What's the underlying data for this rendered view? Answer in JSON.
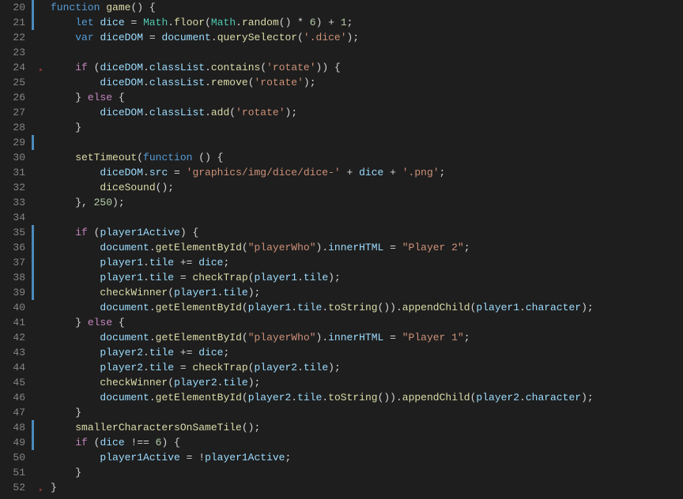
{
  "lineStart": 20,
  "lines": [
    [
      [
        "kw",
        "function"
      ],
      [
        "op",
        " "
      ],
      [
        "fn",
        "game"
      ],
      [
        "pn",
        "() {"
      ]
    ],
    [
      [
        "op",
        "    "
      ],
      [
        "kw",
        "let"
      ],
      [
        "op",
        " "
      ],
      [
        "var",
        "dice"
      ],
      [
        "op",
        " = "
      ],
      [
        "cls",
        "Math"
      ],
      [
        "pn",
        "."
      ],
      [
        "fn",
        "floor"
      ],
      [
        "pn",
        "("
      ],
      [
        "cls",
        "Math"
      ],
      [
        "pn",
        "."
      ],
      [
        "fn",
        "random"
      ],
      [
        "pn",
        "() * "
      ],
      [
        "num",
        "6"
      ],
      [
        "pn",
        ") + "
      ],
      [
        "num",
        "1"
      ],
      [
        "pn",
        ";"
      ]
    ],
    [
      [
        "op",
        "    "
      ],
      [
        "kw",
        "var"
      ],
      [
        "op",
        " "
      ],
      [
        "var",
        "diceDOM"
      ],
      [
        "op",
        " = "
      ],
      [
        "var",
        "document"
      ],
      [
        "pn",
        "."
      ],
      [
        "fn",
        "querySelector"
      ],
      [
        "pn",
        "("
      ],
      [
        "str",
        "'.dice'"
      ],
      [
        "pn",
        ");"
      ]
    ],
    [
      [
        "op",
        ""
      ]
    ],
    [
      [
        "op",
        "    "
      ],
      [
        "ctrl",
        "if"
      ],
      [
        "op",
        " ("
      ],
      [
        "var",
        "diceDOM"
      ],
      [
        "pn",
        "."
      ],
      [
        "prop",
        "classList"
      ],
      [
        "pn",
        "."
      ],
      [
        "fn",
        "contains"
      ],
      [
        "pn",
        "("
      ],
      [
        "str",
        "'rotate'"
      ],
      [
        "pn",
        ")) {"
      ]
    ],
    [
      [
        "op",
        "        "
      ],
      [
        "var",
        "diceDOM"
      ],
      [
        "pn",
        "."
      ],
      [
        "prop",
        "classList"
      ],
      [
        "pn",
        "."
      ],
      [
        "fn",
        "remove"
      ],
      [
        "pn",
        "("
      ],
      [
        "str",
        "'rotate'"
      ],
      [
        "pn",
        ");"
      ]
    ],
    [
      [
        "op",
        "    } "
      ],
      [
        "ctrl",
        "else"
      ],
      [
        "op",
        " {"
      ]
    ],
    [
      [
        "op",
        "        "
      ],
      [
        "var",
        "diceDOM"
      ],
      [
        "pn",
        "."
      ],
      [
        "prop",
        "classList"
      ],
      [
        "pn",
        "."
      ],
      [
        "fn",
        "add"
      ],
      [
        "pn",
        "("
      ],
      [
        "str",
        "'rotate'"
      ],
      [
        "pn",
        ");"
      ]
    ],
    [
      [
        "op",
        "    }"
      ]
    ],
    [
      [
        "op",
        ""
      ]
    ],
    [
      [
        "op",
        "    "
      ],
      [
        "fn",
        "setTimeout"
      ],
      [
        "pn",
        "("
      ],
      [
        "kw",
        "function"
      ],
      [
        "op",
        " () {"
      ]
    ],
    [
      [
        "op",
        "        "
      ],
      [
        "var",
        "diceDOM"
      ],
      [
        "pn",
        "."
      ],
      [
        "prop",
        "src"
      ],
      [
        "op",
        " = "
      ],
      [
        "str",
        "'graphics/img/dice/dice-'"
      ],
      [
        "op",
        " + "
      ],
      [
        "var",
        "dice"
      ],
      [
        "op",
        " + "
      ],
      [
        "str",
        "'.png'"
      ],
      [
        "pn",
        ";"
      ]
    ],
    [
      [
        "op",
        "        "
      ],
      [
        "fn",
        "diceSound"
      ],
      [
        "pn",
        "();"
      ]
    ],
    [
      [
        "op",
        "    }, "
      ],
      [
        "num",
        "250"
      ],
      [
        "pn",
        ");"
      ]
    ],
    [
      [
        "op",
        ""
      ]
    ],
    [
      [
        "op",
        "    "
      ],
      [
        "ctrl",
        "if"
      ],
      [
        "op",
        " ("
      ],
      [
        "var",
        "player1Active"
      ],
      [
        "pn",
        ") {"
      ]
    ],
    [
      [
        "op",
        "        "
      ],
      [
        "var",
        "document"
      ],
      [
        "pn",
        "."
      ],
      [
        "fn",
        "getElementById"
      ],
      [
        "pn",
        "("
      ],
      [
        "str",
        "\"playerWho\""
      ],
      [
        "pn",
        ")."
      ],
      [
        "prop",
        "innerHTML"
      ],
      [
        "op",
        " = "
      ],
      [
        "str",
        "\"Player 2\""
      ],
      [
        "pn",
        ";"
      ]
    ],
    [
      [
        "op",
        "        "
      ],
      [
        "var",
        "player1"
      ],
      [
        "pn",
        "."
      ],
      [
        "prop",
        "tile"
      ],
      [
        "op",
        " += "
      ],
      [
        "var",
        "dice"
      ],
      [
        "pn",
        ";"
      ]
    ],
    [
      [
        "op",
        "        "
      ],
      [
        "var",
        "player1"
      ],
      [
        "pn",
        "."
      ],
      [
        "prop",
        "tile"
      ],
      [
        "op",
        " = "
      ],
      [
        "fn",
        "checkTrap"
      ],
      [
        "pn",
        "("
      ],
      [
        "var",
        "player1"
      ],
      [
        "pn",
        "."
      ],
      [
        "prop",
        "tile"
      ],
      [
        "pn",
        ");"
      ]
    ],
    [
      [
        "op",
        "        "
      ],
      [
        "fn",
        "checkWinner"
      ],
      [
        "pn",
        "("
      ],
      [
        "var",
        "player1"
      ],
      [
        "pn",
        "."
      ],
      [
        "prop",
        "tile"
      ],
      [
        "pn",
        ");"
      ]
    ],
    [
      [
        "op",
        "        "
      ],
      [
        "var",
        "document"
      ],
      [
        "pn",
        "."
      ],
      [
        "fn",
        "getElementById"
      ],
      [
        "pn",
        "("
      ],
      [
        "var",
        "player1"
      ],
      [
        "pn",
        "."
      ],
      [
        "prop",
        "tile"
      ],
      [
        "pn",
        "."
      ],
      [
        "fn",
        "toString"
      ],
      [
        "pn",
        "())."
      ],
      [
        "fn",
        "appendChild"
      ],
      [
        "pn",
        "("
      ],
      [
        "var",
        "player1"
      ],
      [
        "pn",
        "."
      ],
      [
        "prop",
        "character"
      ],
      [
        "pn",
        ");"
      ]
    ],
    [
      [
        "op",
        "    } "
      ],
      [
        "ctrl",
        "else"
      ],
      [
        "op",
        " {"
      ]
    ],
    [
      [
        "op",
        "        "
      ],
      [
        "var",
        "document"
      ],
      [
        "pn",
        "."
      ],
      [
        "fn",
        "getElementById"
      ],
      [
        "pn",
        "("
      ],
      [
        "str",
        "\"playerWho\""
      ],
      [
        "pn",
        ")."
      ],
      [
        "prop",
        "innerHTML"
      ],
      [
        "op",
        " = "
      ],
      [
        "str",
        "\"Player 1\""
      ],
      [
        "pn",
        ";"
      ]
    ],
    [
      [
        "op",
        "        "
      ],
      [
        "var",
        "player2"
      ],
      [
        "pn",
        "."
      ],
      [
        "prop",
        "tile"
      ],
      [
        "op",
        " += "
      ],
      [
        "var",
        "dice"
      ],
      [
        "pn",
        ";"
      ]
    ],
    [
      [
        "op",
        "        "
      ],
      [
        "var",
        "player2"
      ],
      [
        "pn",
        "."
      ],
      [
        "prop",
        "tile"
      ],
      [
        "op",
        " = "
      ],
      [
        "fn",
        "checkTrap"
      ],
      [
        "pn",
        "("
      ],
      [
        "var",
        "player2"
      ],
      [
        "pn",
        "."
      ],
      [
        "prop",
        "tile"
      ],
      [
        "pn",
        ");"
      ]
    ],
    [
      [
        "op",
        "        "
      ],
      [
        "fn",
        "checkWinner"
      ],
      [
        "pn",
        "("
      ],
      [
        "var",
        "player2"
      ],
      [
        "pn",
        "."
      ],
      [
        "prop",
        "tile"
      ],
      [
        "pn",
        ");"
      ]
    ],
    [
      [
        "op",
        "        "
      ],
      [
        "var",
        "document"
      ],
      [
        "pn",
        "."
      ],
      [
        "fn",
        "getElementById"
      ],
      [
        "pn",
        "("
      ],
      [
        "var",
        "player2"
      ],
      [
        "pn",
        "."
      ],
      [
        "prop",
        "tile"
      ],
      [
        "pn",
        "."
      ],
      [
        "fn",
        "toString"
      ],
      [
        "pn",
        "())."
      ],
      [
        "fn",
        "appendChild"
      ],
      [
        "pn",
        "("
      ],
      [
        "var",
        "player2"
      ],
      [
        "pn",
        "."
      ],
      [
        "prop",
        "character"
      ],
      [
        "pn",
        ");"
      ]
    ],
    [
      [
        "op",
        "    }"
      ]
    ],
    [
      [
        "op",
        "    "
      ],
      [
        "fn",
        "smallerCharactersOnSameTile"
      ],
      [
        "pn",
        "();"
      ]
    ],
    [
      [
        "op",
        "    "
      ],
      [
        "ctrl",
        "if"
      ],
      [
        "op",
        " ("
      ],
      [
        "var",
        "dice"
      ],
      [
        "op",
        " !== "
      ],
      [
        "num",
        "6"
      ],
      [
        "pn",
        ") {"
      ]
    ],
    [
      [
        "op",
        "        "
      ],
      [
        "var",
        "player1Active"
      ],
      [
        "op",
        " = !"
      ],
      [
        "var",
        "player1Active"
      ],
      [
        "pn",
        ";"
      ]
    ],
    [
      [
        "op",
        "    }"
      ]
    ],
    [
      [
        "op",
        "}"
      ]
    ]
  ],
  "foldGlyphs": [
    24,
    52
  ],
  "markers": [
    20,
    21,
    29,
    35,
    36,
    37,
    38,
    39,
    48,
    49
  ]
}
